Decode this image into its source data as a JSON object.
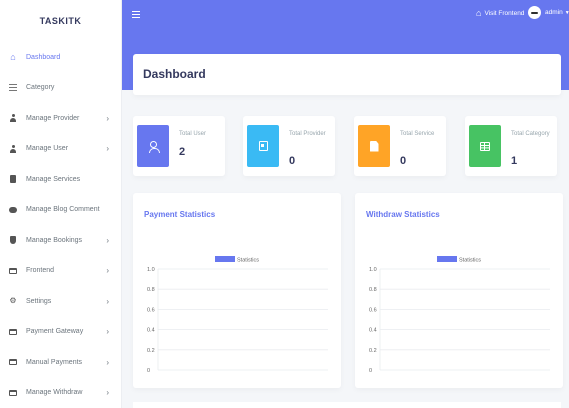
{
  "brand": "TASKITK",
  "sidebar": {
    "items": [
      {
        "label": "Dashboard",
        "icon": "home-icon",
        "chevron": false,
        "active": true
      },
      {
        "label": "Category",
        "icon": "list-icon",
        "chevron": false
      },
      {
        "label": "Manage Provider",
        "icon": "user-icon",
        "chevron": true
      },
      {
        "label": "Manage User",
        "icon": "user-icon",
        "chevron": true
      },
      {
        "label": "Manage Services",
        "icon": "service-icon",
        "chevron": false
      },
      {
        "label": "Manage Blog Comment",
        "icon": "comment-icon",
        "chevron": false
      },
      {
        "label": "Manage Bookings",
        "icon": "booking-icon",
        "chevron": true
      },
      {
        "label": "Frontend",
        "icon": "frontend-icon",
        "chevron": true
      },
      {
        "label": "Settings",
        "icon": "gear-icon",
        "chevron": true
      },
      {
        "label": "Payment Gateway",
        "icon": "card-icon",
        "chevron": true
      },
      {
        "label": "Manual Payments",
        "icon": "card-icon",
        "chevron": true
      },
      {
        "label": "Manage Withdraw",
        "icon": "card-icon",
        "chevron": true
      }
    ],
    "chevron_glyph": "›"
  },
  "header": {
    "visit_label": "Visit Frontend",
    "user_label": "admin"
  },
  "page": {
    "title": "Dashboard"
  },
  "stats": [
    {
      "label": "Total User",
      "value": "2",
      "color": "#6777ef"
    },
    {
      "label": "Total Provider",
      "value": "0",
      "color": "#3abaf4"
    },
    {
      "label": "Total Service",
      "value": "0",
      "color": "#ffa426"
    },
    {
      "label": "Total Category",
      "value": "1",
      "color": "#47c363"
    }
  ],
  "colors": {
    "accent": "#6777ef"
  },
  "chart_data": [
    {
      "type": "bar",
      "title": "Payment Statistics",
      "categories": [],
      "series": [
        {
          "name": "Statistics",
          "values": [],
          "color": "#6777ef"
        }
      ],
      "ylim": [
        0,
        1.0
      ],
      "yticks": [
        "1.0",
        "0.8",
        "0.6",
        "0.4",
        "0.2",
        "0"
      ],
      "legend": "top"
    },
    {
      "type": "bar",
      "title": "Withdraw Statistics",
      "categories": [],
      "series": [
        {
          "name": "Statistics",
          "values": [],
          "color": "#6777ef"
        }
      ],
      "ylim": [
        0,
        1.0
      ],
      "yticks": [
        "1.0",
        "0.8",
        "0.6",
        "0.4",
        "0.2",
        "0"
      ],
      "legend": "top"
    }
  ]
}
